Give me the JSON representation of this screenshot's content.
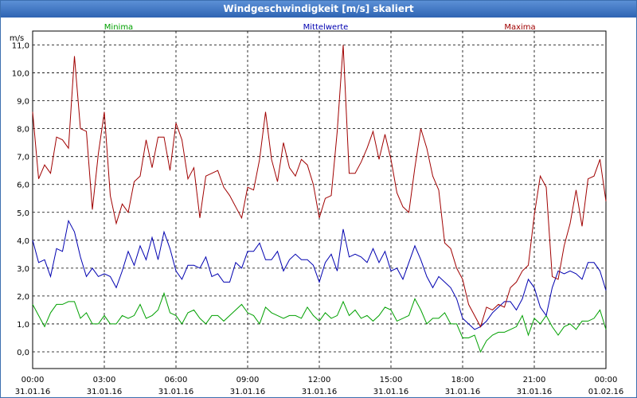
{
  "window": {
    "title": "Windgeschwindigkeit [m/s] skaliert"
  },
  "chart_data": {
    "type": "line",
    "title": "Windgeschwindigkeit [m/s] skaliert",
    "ylabel": "m/s",
    "xlabel": "",
    "ylim": [
      -0.6,
      11.5
    ],
    "grid": true,
    "legend_placement": "top",
    "y_ticks": [
      "0,0",
      "1,0",
      "2,0",
      "3,0",
      "4,0",
      "5,0",
      "6,0",
      "7,0",
      "8,0",
      "9,0",
      "10,0",
      "11,0"
    ],
    "x_ticks": [
      {
        "time": "00:00",
        "date": "31.01.16"
      },
      {
        "time": "03:00",
        "date": "31.01.16"
      },
      {
        "time": "06:00",
        "date": "31.01.16"
      },
      {
        "time": "09:00",
        "date": "31.01.16"
      },
      {
        "time": "12:00",
        "date": "31.01.16"
      },
      {
        "time": "15:00",
        "date": "31.01.16"
      },
      {
        "time": "18:00",
        "date": "31.01.16"
      },
      {
        "time": "21:00",
        "date": "31.01.16"
      },
      {
        "time": "00:00",
        "date": "01.02.16"
      }
    ],
    "x_hours_range": [
      0,
      24
    ],
    "series": [
      {
        "name": "Minima",
        "color": "#00a000",
        "x_hours": [
          0,
          0.25,
          0.5,
          0.75,
          1,
          1.25,
          1.5,
          1.75,
          2,
          2.25,
          2.5,
          2.75,
          3,
          3.25,
          3.5,
          3.75,
          4,
          4.25,
          4.5,
          4.75,
          5,
          5.25,
          5.5,
          5.75,
          6,
          6.25,
          6.5,
          6.75,
          7,
          7.25,
          7.5,
          7.75,
          8,
          8.25,
          8.5,
          8.75,
          9,
          9.25,
          9.5,
          9.75,
          10,
          10.25,
          10.5,
          10.75,
          11,
          11.25,
          11.5,
          11.75,
          12,
          12.25,
          12.5,
          12.75,
          13,
          13.25,
          13.5,
          13.75,
          14,
          14.25,
          14.5,
          14.75,
          15,
          15.25,
          15.5,
          15.75,
          16,
          16.25,
          16.5,
          16.75,
          17,
          17.25,
          17.5,
          17.75,
          18,
          18.25,
          18.5,
          18.75,
          19,
          19.25,
          19.5,
          19.75,
          20,
          20.25,
          20.5,
          20.75,
          21,
          21.25,
          21.5,
          21.75,
          22,
          22.25,
          22.5,
          22.75,
          23,
          23.25,
          23.5,
          23.75,
          24
        ],
        "values": [
          1.7,
          1.3,
          0.9,
          1.4,
          1.7,
          1.7,
          1.8,
          1.8,
          1.2,
          1.4,
          1.0,
          1.0,
          1.3,
          1.0,
          1.0,
          1.3,
          1.2,
          1.3,
          1.7,
          1.2,
          1.3,
          1.5,
          2.1,
          1.4,
          1.3,
          1.0,
          1.4,
          1.5,
          1.2,
          1.0,
          1.3,
          1.3,
          1.1,
          1.3,
          1.5,
          1.7,
          1.4,
          1.3,
          1.0,
          1.6,
          1.4,
          1.3,
          1.2,
          1.3,
          1.3,
          1.2,
          1.6,
          1.3,
          1.1,
          1.4,
          1.2,
          1.3,
          1.8,
          1.3,
          1.5,
          1.2,
          1.3,
          1.1,
          1.3,
          1.6,
          1.5,
          1.1,
          1.2,
          1.3,
          1.9,
          1.5,
          1.0,
          1.2,
          1.2,
          1.4,
          1.0,
          1.0,
          0.5,
          0.5,
          0.6,
          0.0,
          0.4,
          0.6,
          0.7,
          0.7,
          0.8,
          0.9,
          1.3,
          0.6,
          1.2,
          1.0,
          1.3,
          0.9,
          0.6,
          0.9,
          1.0,
          0.8,
          1.1,
          1.1,
          1.2,
          1.5,
          0.8,
          0.8,
          0.8
        ]
      },
      {
        "name": "Mittelwerte",
        "color": "#0000b0",
        "x_hours": [
          0,
          0.25,
          0.5,
          0.75,
          1,
          1.25,
          1.5,
          1.75,
          2,
          2.25,
          2.5,
          2.75,
          3,
          3.25,
          3.5,
          3.75,
          4,
          4.25,
          4.5,
          4.75,
          5,
          5.25,
          5.5,
          5.75,
          6,
          6.25,
          6.5,
          6.75,
          7,
          7.25,
          7.5,
          7.75,
          8,
          8.25,
          8.5,
          8.75,
          9,
          9.25,
          9.5,
          9.75,
          10,
          10.25,
          10.5,
          10.75,
          11,
          11.25,
          11.5,
          11.75,
          12,
          12.25,
          12.5,
          12.75,
          13,
          13.25,
          13.5,
          13.75,
          14,
          14.25,
          14.5,
          14.75,
          15,
          15.25,
          15.5,
          15.75,
          16,
          16.25,
          16.5,
          16.75,
          17,
          17.25,
          17.5,
          17.75,
          18,
          18.25,
          18.5,
          18.75,
          19,
          19.25,
          19.5,
          19.75,
          20,
          20.25,
          20.5,
          20.75,
          21,
          21.25,
          21.5,
          21.75,
          22,
          22.25,
          22.5,
          22.75,
          23,
          23.25,
          23.5,
          23.75,
          24
        ],
        "values": [
          4.0,
          3.2,
          3.3,
          2.7,
          3.7,
          3.6,
          4.7,
          4.3,
          3.4,
          2.7,
          3.0,
          2.7,
          2.8,
          2.7,
          2.3,
          2.9,
          3.6,
          3.1,
          3.8,
          3.3,
          4.1,
          3.3,
          4.3,
          3.7,
          2.9,
          2.6,
          3.1,
          3.1,
          3.0,
          3.4,
          2.7,
          2.8,
          2.5,
          2.5,
          3.2,
          3.0,
          3.6,
          3.6,
          3.9,
          3.3,
          3.3,
          3.6,
          2.9,
          3.3,
          3.5,
          3.3,
          3.3,
          3.1,
          2.5,
          3.2,
          3.5,
          2.9,
          4.4,
          3.4,
          3.5,
          3.4,
          3.2,
          3.7,
          3.2,
          3.6,
          2.9,
          3.0,
          2.6,
          3.2,
          3.8,
          3.3,
          2.7,
          2.3,
          2.7,
          2.5,
          2.3,
          1.9,
          1.2,
          1.0,
          0.8,
          0.9,
          1.1,
          1.4,
          1.6,
          1.8,
          1.8,
          1.5,
          1.9,
          2.6,
          2.3,
          1.6,
          1.3,
          2.3,
          2.9,
          2.8,
          2.9,
          2.8,
          2.6,
          3.2,
          3.2,
          2.9,
          2.2,
          2.2,
          2.4
        ]
      },
      {
        "name": "Maxima",
        "color": "#a00000",
        "x_hours": [
          0,
          0.25,
          0.5,
          0.75,
          1,
          1.25,
          1.5,
          1.75,
          2,
          2.25,
          2.5,
          2.75,
          3,
          3.25,
          3.5,
          3.75,
          4,
          4.25,
          4.5,
          4.75,
          5,
          5.25,
          5.5,
          5.75,
          6,
          6.25,
          6.5,
          6.75,
          7,
          7.25,
          7.5,
          7.75,
          8,
          8.25,
          8.5,
          8.75,
          9,
          9.25,
          9.5,
          9.75,
          10,
          10.25,
          10.5,
          10.75,
          11,
          11.25,
          11.5,
          11.75,
          12,
          12.25,
          12.5,
          12.75,
          13,
          13.25,
          13.5,
          13.75,
          14,
          14.25,
          14.5,
          14.75,
          15,
          15.25,
          15.5,
          15.75,
          16,
          16.25,
          16.5,
          16.75,
          17,
          17.25,
          17.5,
          17.75,
          18,
          18.25,
          18.5,
          18.75,
          19,
          19.25,
          19.5,
          19.75,
          20,
          20.25,
          20.5,
          20.75,
          21,
          21.25,
          21.5,
          21.75,
          22,
          22.25,
          22.5,
          22.75,
          23,
          23.25,
          23.5,
          23.75,
          24
        ],
        "values": [
          8.6,
          6.2,
          6.7,
          6.4,
          7.7,
          7.6,
          7.3,
          10.6,
          8.0,
          7.9,
          5.1,
          7.1,
          8.6,
          5.6,
          4.6,
          5.3,
          5.0,
          6.1,
          6.3,
          7.6,
          6.6,
          7.7,
          7.7,
          6.5,
          8.2,
          7.6,
          6.2,
          6.6,
          4.8,
          6.3,
          6.4,
          6.5,
          5.9,
          5.6,
          5.2,
          4.8,
          5.9,
          5.8,
          6.9,
          8.6,
          6.9,
          6.1,
          7.5,
          6.6,
          6.3,
          6.9,
          6.7,
          6.0,
          4.8,
          5.5,
          5.6,
          7.9,
          11.0,
          6.4,
          6.4,
          6.8,
          7.3,
          7.9,
          6.9,
          7.8,
          6.9,
          5.7,
          5.2,
          5.0,
          6.6,
          8.0,
          7.3,
          6.3,
          5.8,
          3.9,
          3.7,
          3.0,
          2.6,
          1.7,
          1.3,
          0.9,
          1.6,
          1.5,
          1.7,
          1.6,
          2.3,
          2.5,
          2.9,
          3.1,
          4.9,
          6.3,
          5.9,
          2.7,
          2.6,
          3.8,
          4.6,
          5.8,
          4.5,
          6.2,
          6.3,
          6.9,
          5.4,
          5.6,
          4.8
        ]
      }
    ]
  }
}
